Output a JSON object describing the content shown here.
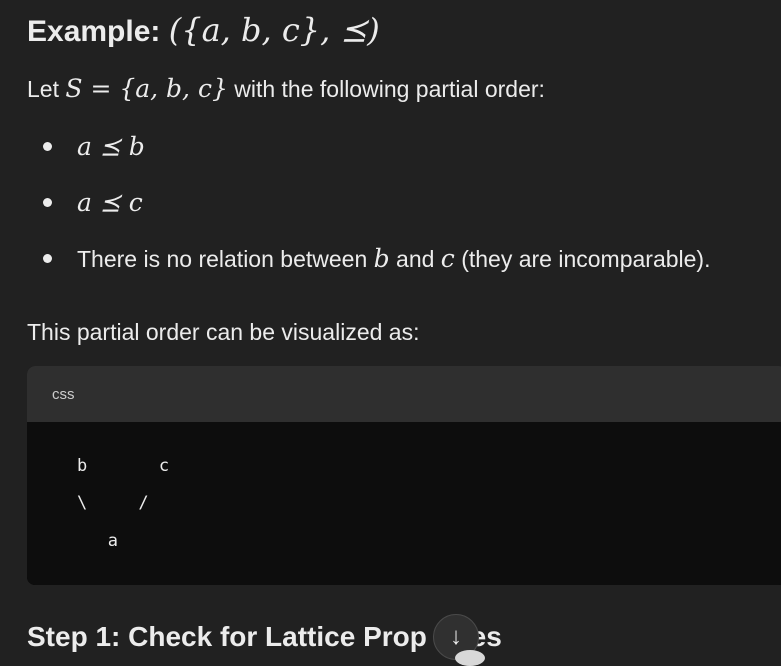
{
  "heading": {
    "prefix": "Example: ",
    "math": "({a, b, c}, ⪯)"
  },
  "intro": {
    "lead": "Let ",
    "math": "S = {a, b, c}",
    "tail": " with the following partial order:"
  },
  "bullets": [
    {
      "math": "a ⪯ b"
    },
    {
      "math": "a ⪯ c"
    },
    {
      "text_before": "There is no relation between ",
      "var1": "b",
      "text_mid": " and ",
      "var2": "c",
      "text_after": " (they are incomparable)."
    }
  ],
  "visualize_text": "This partial order can be visualized as:",
  "code_block": {
    "language": "css",
    "lines": [
      "b       c",
      "\\     /",
      "   a"
    ]
  },
  "step_heading": "Step 1: Check for Lattice Prop",
  "step_heading_tail": "ies",
  "scroll_button": {
    "icon": "arrow-down-icon",
    "glyph": "↓"
  }
}
